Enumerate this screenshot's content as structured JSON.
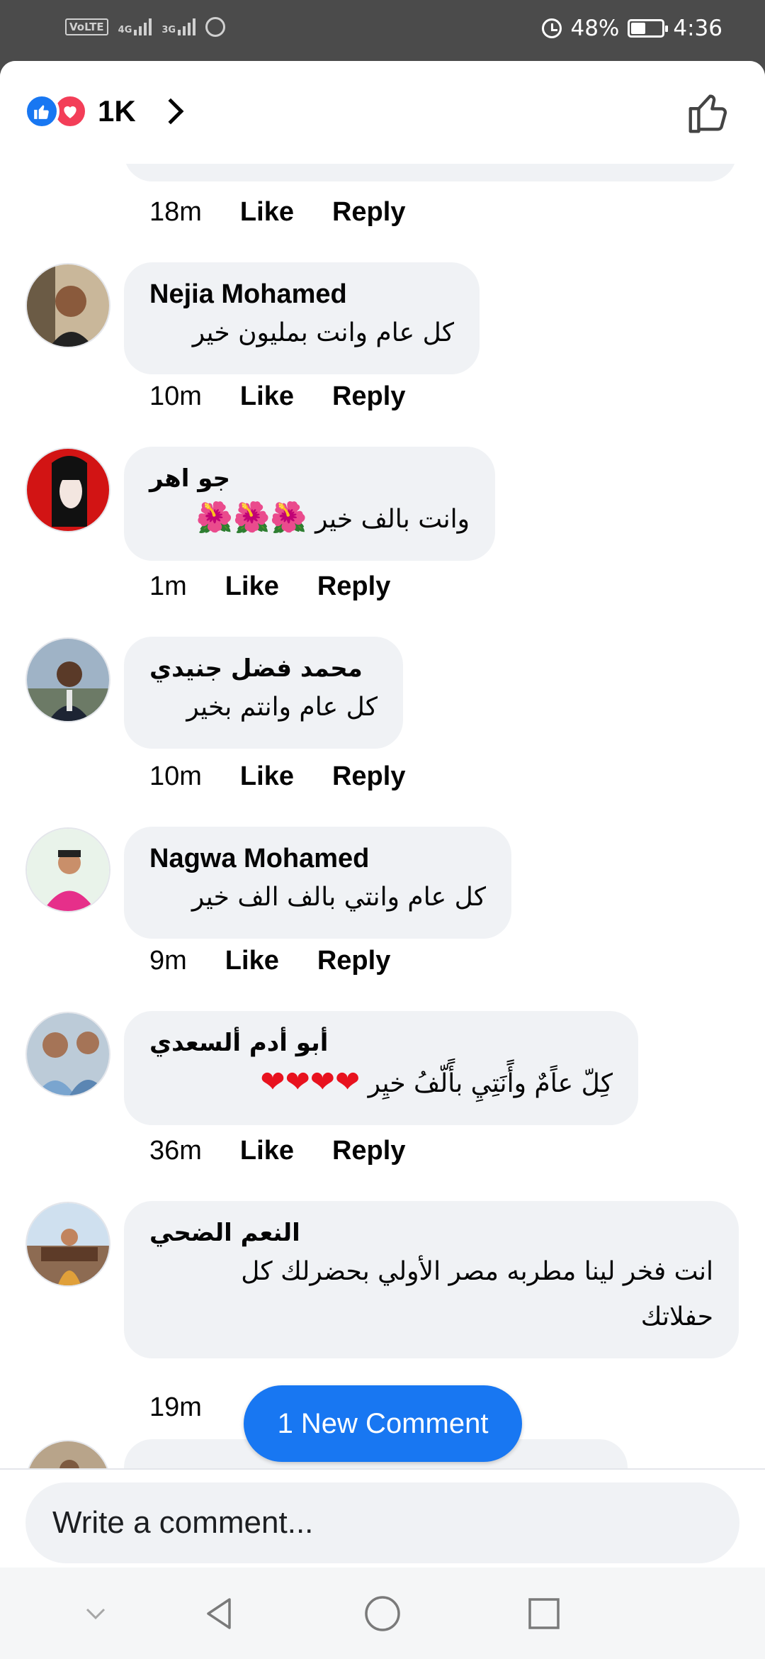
{
  "status_bar": {
    "volte": "VoLTE",
    "net1": "4G",
    "net2": "3G",
    "battery_pct_text": "48%",
    "battery_level": 0.48,
    "time": "4:36"
  },
  "header": {
    "reaction_count": "1K",
    "icons": [
      "like-reaction-icon",
      "love-reaction-icon",
      "chevron-right-icon",
      "thumbs-up-icon"
    ],
    "accent": "#1877f2",
    "love": "#f33e58"
  },
  "top_meta": {
    "time": "18m",
    "like": "Like",
    "reply": "Reply"
  },
  "comments": [
    {
      "author": "Nejia Mohamed",
      "text": "كل عام وانت بمليون خير",
      "time": "10m",
      "like": "Like",
      "reply": "Reply"
    },
    {
      "author": "جو اهر",
      "text": "وانت بالف خير",
      "emoji": "🌺🌺🌺",
      "time": "1m",
      "like": "Like",
      "reply": "Reply"
    },
    {
      "author": "محمد فضل جنيدي",
      "text": "كل عام وانتم بخير",
      "time": "10m",
      "like": "Like",
      "reply": "Reply"
    },
    {
      "author": "Nagwa Mohamed",
      "text": "كل عام وانتي بالف الف خير",
      "time": "9m",
      "like": "Like",
      "reply": "Reply"
    },
    {
      "author": "أبو أدم ألسعدي",
      "text": "كِلّ عاًمٌ وأًنَتِيِ بأًلّفُ خيِر",
      "emoji": "❤❤❤❤",
      "time": "36m",
      "like": "Like",
      "reply": "Reply"
    },
    {
      "author": "النعم الضحي",
      "text_line1": "انت فخر لينا مطربه مصر الأولي بحضرلك كل",
      "text_line2": "حفلاتك",
      "time": "19m"
    }
  ],
  "new_comment_pill": "1 New Comment",
  "composer": {
    "placeholder": "Write a comment..."
  },
  "nav": [
    "collapse-icon",
    "back-icon",
    "home-icon",
    "recents-icon"
  ]
}
